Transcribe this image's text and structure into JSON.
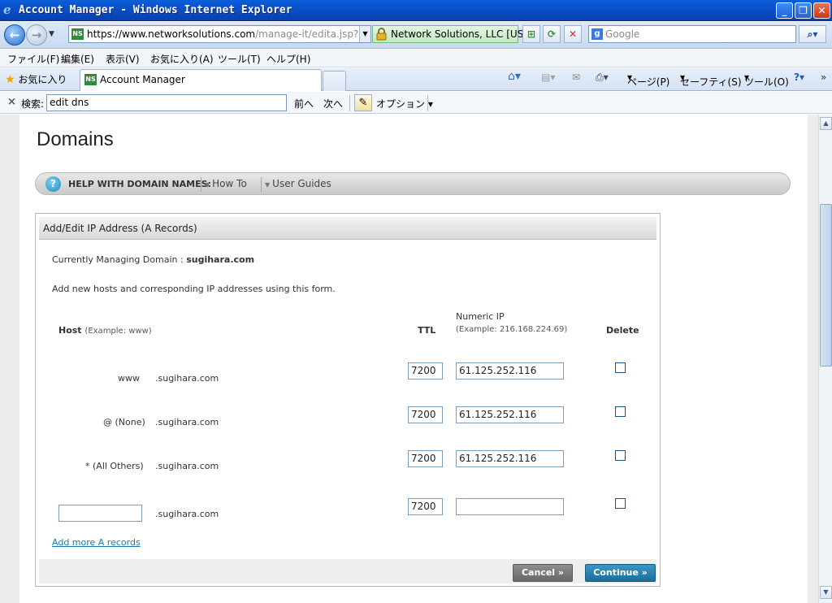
{
  "browser": {
    "window_title": "Account Manager - Windows Internet Explorer",
    "url_prefix": "https://www.",
    "url_host": "networksolutions.com",
    "url_path": "/manage-it/edita.jsp?refreshFi",
    "cert_label": "Network Solutions, LLC [US]",
    "search_placeholder": "Google",
    "menu": [
      "ファイル(F)",
      "編集(E)",
      "表示(V)",
      "お気に入り(A)",
      "ツール(T)",
      "ヘルプ(H)"
    ],
    "favorites_label": "お気に入り",
    "active_tab": "Account Manager",
    "command_bar": {
      "page": "ページ(P)",
      "safety": "セーフティ(S)",
      "tools": "ツール(O)"
    },
    "find_bar": {
      "label": "検索:",
      "value": "edit dns",
      "prev": "前へ",
      "next": "次へ",
      "options": "オプション"
    }
  },
  "page": {
    "title": "Domains",
    "help": {
      "label": "HELP WITH DOMAIN NAMES:",
      "how_to": "How To",
      "user_guides": "User Guides"
    },
    "panel": {
      "heading": "Add/Edit IP Address (A Records)",
      "managing_label": "Currently Managing Domain :",
      "managing_domain": "sugihara.com",
      "intro": "Add new hosts and corresponding IP addresses using this form.",
      "col_host": "Host",
      "col_host_example": "(Example: www)",
      "col_ttl": "TTL",
      "col_ip": "Numeric IP",
      "col_ip_example": "(Example: 216.168.224.69)",
      "col_delete": "Delete",
      "rows": [
        {
          "host": "www",
          "suffix": ".sugihara.com",
          "ttl": "7200",
          "ip": "61.125.252.116"
        },
        {
          "host": "@ (None)",
          "suffix": ".sugihara.com",
          "ttl": "7200",
          "ip": "61.125.252.116"
        },
        {
          "host": "* (All Others)",
          "suffix": ".sugihara.com",
          "ttl": "7200",
          "ip": "61.125.252.116"
        },
        {
          "host": "",
          "suffix": ".sugihara.com",
          "ttl": "7200",
          "ip": ""
        }
      ],
      "add_more": "Add more A records",
      "cancel": "Cancel »",
      "continue": "Continue »"
    }
  }
}
